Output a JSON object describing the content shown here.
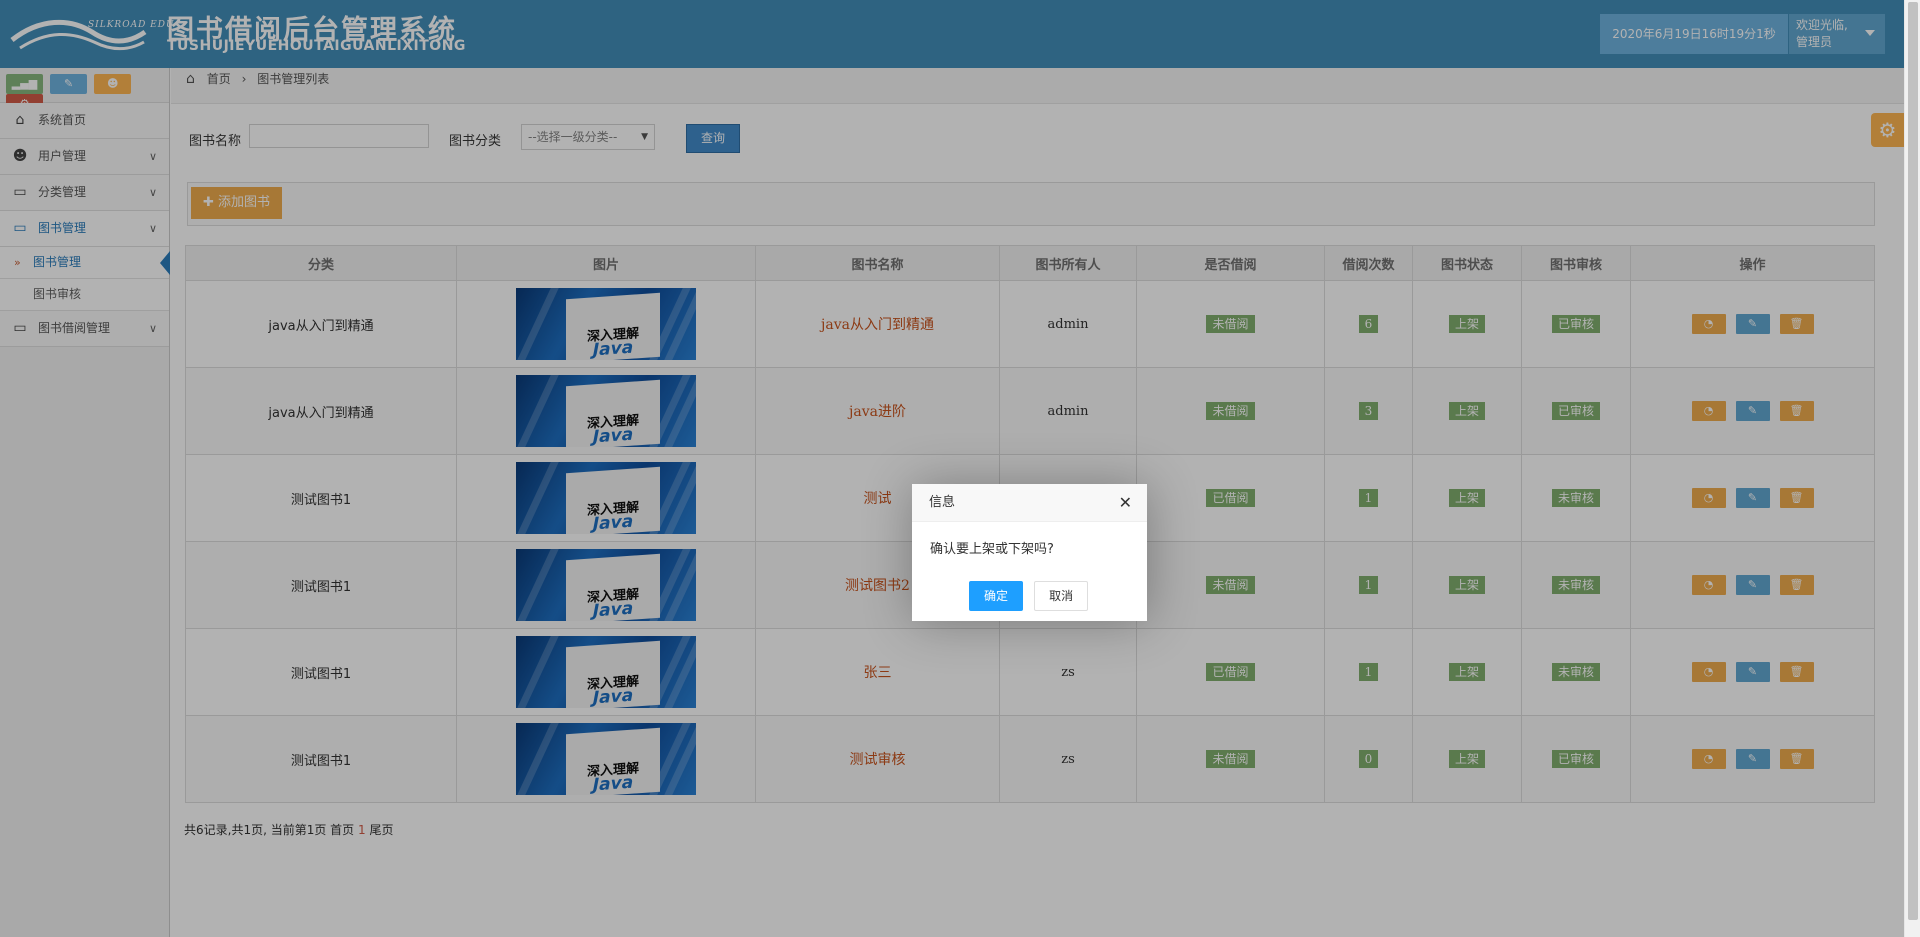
{
  "header": {
    "logo_text": "SILKROAD EDU",
    "title": "图书借阅后台管理系统",
    "subtitle": "TUSHUJIEYUEHOUTAIGUANLIXITONG",
    "datetime": "2020年6月19日16时19分1秒",
    "welcome": "欢迎光临,",
    "role": "管理员"
  },
  "sidebar": {
    "items": [
      {
        "label": "系统首页",
        "icon": "home-icon"
      },
      {
        "label": "用户管理",
        "icon": "users-icon"
      },
      {
        "label": "分类管理",
        "icon": "desktop-icon"
      },
      {
        "label": "图书管理",
        "icon": "desktop-icon"
      },
      {
        "label": "图书借阅管理",
        "icon": "desktop-icon"
      }
    ],
    "subitems": [
      "图书管理",
      "图书审核"
    ]
  },
  "breadcrumb": {
    "home": "首页",
    "current": "图书管理列表"
  },
  "search": {
    "name_label": "图书名称",
    "name_value": "",
    "category_label": "图书分类",
    "category_selected": "--选择一级分类--",
    "query_label": "查询"
  },
  "toolbar": {
    "add_label": "添加图书"
  },
  "table": {
    "headers": [
      "分类",
      "图片",
      "图书名称",
      "图书所有人",
      "是否借阅",
      "借阅次数",
      "图书状态",
      "图书审核",
      "操作"
    ],
    "rows": [
      {
        "category": "java从入门到精通",
        "name": "java从入门到精通",
        "owner": "admin",
        "borrowed": "未借阅",
        "count": "6",
        "status": "上架",
        "review": "已审核"
      },
      {
        "category": "java从入门到精通",
        "name": "java进阶",
        "owner": "admin",
        "borrowed": "未借阅",
        "count": "3",
        "status": "上架",
        "review": "已审核"
      },
      {
        "category": "测试图书1",
        "name": "测试",
        "owner": "",
        "borrowed": "已借阅",
        "count": "1",
        "status": "上架",
        "review": "未审核"
      },
      {
        "category": "测试图书1",
        "name": "测试图书2",
        "owner": "",
        "borrowed": "未借阅",
        "count": "1",
        "status": "上架",
        "review": "未审核"
      },
      {
        "category": "测试图书1",
        "name": "张三",
        "owner": "zs",
        "borrowed": "已借阅",
        "count": "1",
        "status": "上架",
        "review": "未审核"
      },
      {
        "category": "测试图书1",
        "name": "测试审核",
        "owner": "zs",
        "borrowed": "未借阅",
        "count": "0",
        "status": "上架",
        "review": "已审核"
      }
    ],
    "cover_title": "深入理解",
    "cover_java": "Java"
  },
  "pager": {
    "text": "共6记录,共1页, 当前第1页 首页",
    "current": "1",
    "last": "尾页"
  },
  "dialog": {
    "title": "信息",
    "message": "确认要上架或下架吗?",
    "ok_label": "确定",
    "cancel_label": "取消"
  },
  "colors": {
    "header": "#438eb9",
    "accent": "#2b7dbc",
    "warning": "#f0ad4e",
    "info": "#62a8d1",
    "success": "#82af6f",
    "danger": "#d15b47"
  }
}
